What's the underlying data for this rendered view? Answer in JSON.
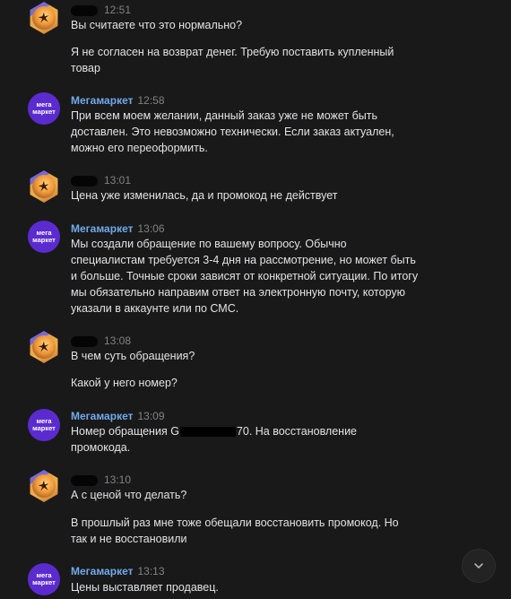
{
  "messages": [
    {
      "author": "user",
      "author_name": "",
      "time": "12:51",
      "lines": [
        "Вы считаете что это нормально?",
        "",
        "Я не согласен на возврат денег. Требую поставить купленный",
        "товар"
      ]
    },
    {
      "author": "brand",
      "author_name": "Мегамаркет",
      "time": "12:58",
      "lines": [
        "При всем моем желании, данный заказ уже не может быть",
        "доставлен. Это невозможно технически. Если заказ актуален,",
        "можно его переоформить."
      ]
    },
    {
      "author": "user",
      "author_name": "",
      "time": "13:01",
      "lines": [
        "Цена уже изменилась, да и промокод не действует"
      ]
    },
    {
      "author": "brand",
      "author_name": "Мегамаркет",
      "time": "13:06",
      "lines": [
        "Мы создали обращение по вашему вопросу. Обычно",
        "специалистам требуется 3-4 дня на рассмотрение, но может быть",
        "и больше. Точные сроки зависят от конкретной ситуации. По итогу",
        "мы обязательно направим ответ на электронную почту, которую",
        "указали в аккаунте или по СМС."
      ]
    },
    {
      "author": "user",
      "author_name": "",
      "time": "13:08",
      "lines": [
        "В чем суть обращения?",
        "",
        "Какой у него номер?"
      ]
    },
    {
      "author": "brand",
      "author_name": "Мегамаркет",
      "time": "13:09",
      "redacted_line": {
        "before": "Номер обращения G",
        "after": "70. На восстановление"
      },
      "lines": [
        "промокода."
      ]
    },
    {
      "author": "user",
      "author_name": "",
      "time": "13:10",
      "lines": [
        "А с ценой что делать?",
        "",
        "В прошлый раз мне тоже обещали восстановить промокод. Но",
        "так и не восстановили"
      ]
    },
    {
      "author": "brand",
      "author_name": "Мегамаркет",
      "time": "13:13",
      "lines": [
        "Цены выставляет продавец."
      ]
    }
  ],
  "brand_avatar_text": [
    "мега",
    "маркет"
  ],
  "icons": {
    "user_avatar": "user-avatar-icon",
    "brand_avatar": "megamarket-logo-icon",
    "scroll_down": "chevron-down-icon"
  },
  "colors": {
    "background": "#191919",
    "text": "#e1e3e6",
    "brand_name": "#71aaeb",
    "time": "#828282",
    "brand_avatar": "#5b2bd0"
  }
}
